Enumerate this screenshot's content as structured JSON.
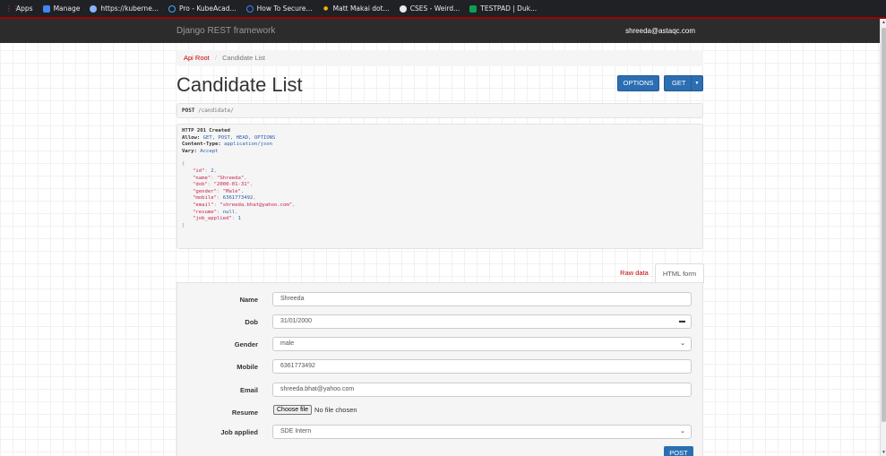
{
  "bookmarks": [
    {
      "label": "Apps",
      "icon": "apps-grid-icon",
      "color": "#e8453c"
    },
    {
      "label": "Manage",
      "icon": "bookmark-icon",
      "color": "#4285f4"
    },
    {
      "label": "https://kuberne...",
      "icon": "globe-icon",
      "color": "#8ab4f8"
    },
    {
      "label": "Pro - KubeAcad...",
      "icon": "loader-icon",
      "color": "#4aa3ff"
    },
    {
      "label": "How To Secure...",
      "icon": "loader-icon",
      "color": "#3b82f6"
    },
    {
      "label": "Matt Makai dot...",
      "icon": "lightbulb-icon",
      "color": "#f4b400"
    },
    {
      "label": "CSES - Weird...",
      "icon": "globe-icon",
      "color": "#e8eaed"
    },
    {
      "label": "TESTPAD | Duk...",
      "icon": "bookmark-icon",
      "color": "#0f9d58"
    }
  ],
  "navbar": {
    "brand": "Django REST framework",
    "user": "shreeda@astaqc.com"
  },
  "breadcrumb": {
    "root": "Api Root",
    "separator": "/",
    "current": "Candidate List"
  },
  "page": {
    "title": "Candidate List",
    "options_label": "OPTIONS",
    "get_label": "GET"
  },
  "request": {
    "method": "POST",
    "path": "/candidate/"
  },
  "response": {
    "status": "HTTP 201 Created",
    "headers": [
      {
        "name": "Allow:",
        "value": "GET, POST, HEAD, OPTIONS"
      },
      {
        "name": "Content-Type:",
        "value": "application/json"
      },
      {
        "name": "Vary:",
        "value": "Accept"
      }
    ],
    "open_brace": "{",
    "close_brace": "}",
    "body": [
      {
        "key": "\"id\"",
        "value": "2",
        "kind": "num",
        "comma": ","
      },
      {
        "key": "\"name\"",
        "value": "\"Shreeda\"",
        "kind": "str",
        "comma": ","
      },
      {
        "key": "\"dob\"",
        "value": "\"2000-01-31\"",
        "kind": "str",
        "comma": ","
      },
      {
        "key": "\"gender\"",
        "value": "\"Male\"",
        "kind": "str",
        "comma": ","
      },
      {
        "key": "\"mobile\"",
        "value": "6361773492",
        "kind": "num",
        "comma": ","
      },
      {
        "key": "\"email\"",
        "value": "\"shreeda.bhat@yahoo.com\"",
        "kind": "str",
        "comma": ","
      },
      {
        "key": "\"resume\"",
        "value": "null",
        "kind": "lit",
        "comma": ","
      },
      {
        "key": "\"job_applied\"",
        "value": "1",
        "kind": "num",
        "comma": ""
      }
    ]
  },
  "tabs": {
    "raw": "Raw data",
    "html": "HTML form"
  },
  "form": {
    "name": {
      "label": "Name",
      "value": "Shreeda"
    },
    "dob": {
      "label": "Dob",
      "value": "31/01/2000"
    },
    "gender": {
      "label": "Gender",
      "value": "male"
    },
    "mobile": {
      "label": "Mobile",
      "value": "6361773492"
    },
    "email": {
      "label": "Email",
      "value": "shreeda.bhat@yahoo.com"
    },
    "resume": {
      "label": "Resume",
      "button": "Choose file",
      "status": "No file chosen"
    },
    "job_applied": {
      "label": "Job applied",
      "value": "SDE Intern"
    },
    "submit": "POST"
  }
}
